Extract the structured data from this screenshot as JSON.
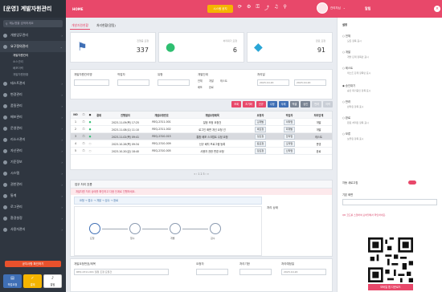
{
  "app": {
    "title": "[운영] 계발자원관리"
  },
  "colors": {
    "accent": "#e8486a",
    "sidebar": "#2f3640",
    "notice": "#f5b400",
    "primary_btn": "#3f6fb5"
  },
  "sidebar": {
    "search_placeholder": "메뉴명을 검색하세요",
    "items": [
      {
        "label": "개발업무관리"
      },
      {
        "label": "요구정의관리"
      },
      {
        "label": "개발자원관리"
      },
      {
        "label": "테스트관리"
      },
      {
        "label": "변경관리"
      },
      {
        "label": "품질관리"
      },
      {
        "label": "배포관리"
      },
      {
        "label": "운영관리"
      },
      {
        "label": "리소스관리"
      },
      {
        "label": "자산관리"
      },
      {
        "label": "기준정보"
      },
      {
        "label": "시스템"
      },
      {
        "label": "권한관리"
      },
      {
        "label": "통계"
      },
      {
        "label": "로그관리"
      },
      {
        "label": "환경설정"
      },
      {
        "label": "사용자관리"
      }
    ],
    "subitems": [
      "개발자원관리",
      "소스관리",
      "배포이력",
      "개발자원현황"
    ],
    "alert": "공지사항 확인하기",
    "tiles": [
      {
        "label": "작업요청"
      },
      {
        "label": "결재"
      },
      {
        "label": "알림"
      }
    ]
  },
  "topbar": {
    "home": "HOME",
    "notice": "시스템 공지",
    "icons": [
      "refresh-icon",
      "settings-icon",
      "lock-icon",
      "share-icon",
      "bell-icon",
      "search-icon"
    ],
    "user": "관리자님",
    "right": "알림"
  },
  "main": {
    "tabs": [
      "개발자원현황",
      "처리현황(알림)"
    ],
    "stats": [
      {
        "icon": "flag-icon",
        "label": "진행중 요청",
        "value": "337"
      },
      {
        "icon": "chat-icon",
        "label": "처리대기 요청",
        "value": "6"
      },
      {
        "icon": "box-icon",
        "label": "완료 요청",
        "value": "91"
      }
    ],
    "filter": {
      "labels": [
        "개발자원관리명",
        "작업자",
        "유형",
        "개발단계",
        "처리일"
      ],
      "date_value": "2023-10-20",
      "checks": [
        "전체",
        "개발",
        "테스트",
        "배포",
        "완료"
      ]
    },
    "buttons": [
      "조회",
      "초기화",
      "신규",
      "수정",
      "삭제",
      "엑셀",
      "승인",
      "반려",
      "이력"
    ],
    "table": {
      "headers": [
        "NO",
        "☐",
        "●",
        "결재",
        "진행일자",
        "개발요청번호",
        "개발요청제목",
        "요청자",
        "작업자",
        "처리단계"
      ],
      "rows": [
        [
          "1",
          "☐",
          "●",
          "",
          "2023-11-09(목) 17:25",
          "REQ-2311-001",
          "일정 조정 요청건",
          "김개발",
          "이작업",
          "개발"
        ],
        [
          "2",
          "☐",
          "●",
          "",
          "2023-11-08(수) 11:10",
          "REQ-2311-002",
          "로그인 화면 개선 요청 건",
          "박요청",
          "최개발",
          "개발"
        ],
        [
          "3",
          "☐",
          "●",
          "",
          "2023-11-02(목) 09:41",
          "REQ-2310-015",
          "통합 배포 스크립트 수정 요청",
          "정요청",
          "한작업",
          "테스트"
        ],
        [
          "4",
          "☐",
          "○",
          "",
          "2023-10-26(목) 09:34",
          "REQ-2310-009",
          "신규 배치 프로그램 등록",
          "윤요청",
          "오작업",
          "운영"
        ],
        [
          "5",
          "☐",
          "○",
          "",
          "2023-10-20(금) 18:40",
          "REQ-2310-005",
          "사용자 권한 변경 요청",
          "장요청",
          "신작업",
          "완료"
        ]
      ],
      "selected_row": 2
    },
    "pager": "« ‹ 1 2 3 › »",
    "flow": {
      "title": "업무 처리 흐름",
      "note": "개발자원 처리 상태를 확인하고 다음 단계로 진행하세요.",
      "steps": "요청 → 접수 → 개발 → 검수 → 완료",
      "nodes": [
        "요청",
        "접수",
        "개발",
        "검수"
      ],
      "side_label": "처리 상태"
    },
    "form": {
      "labels": [
        "개발요청번호/제목",
        "요청자",
        "처리기한",
        "처리예정일"
      ],
      "value_title": "REQ-2311-001 일정 조정 요청건",
      "value_date": "2023-10-20"
    }
  },
  "rpanel": {
    "title": "설정",
    "options": [
      {
        "label": "○ 전체",
        "desc": "모든 항목 표시"
      },
      {
        "label": "○ 개발",
        "desc": "개발 단계 항목만 표시"
      },
      {
        "label": "○ 테스트",
        "desc": "테스트 단계 항목만 표시"
      },
      {
        "label": "◉ 승인대기",
        "desc": "승인 대기중인 항목 표시"
      },
      {
        "label": "○ 반려",
        "desc": "반려된 항목 표시"
      },
      {
        "label": "○ 완료",
        "desc": "완료 처리된 항목 표시"
      },
      {
        "label": "○ 보류",
        "desc": "보류된 항목 표시"
      }
    ],
    "toggle_label": "자동 새로고침",
    "select_label": "기본 화면",
    "info": "QR 코드를 스캔하여 모바일에서 확인하세요.",
    "qr_button": "모바일 앱 다운로드"
  }
}
